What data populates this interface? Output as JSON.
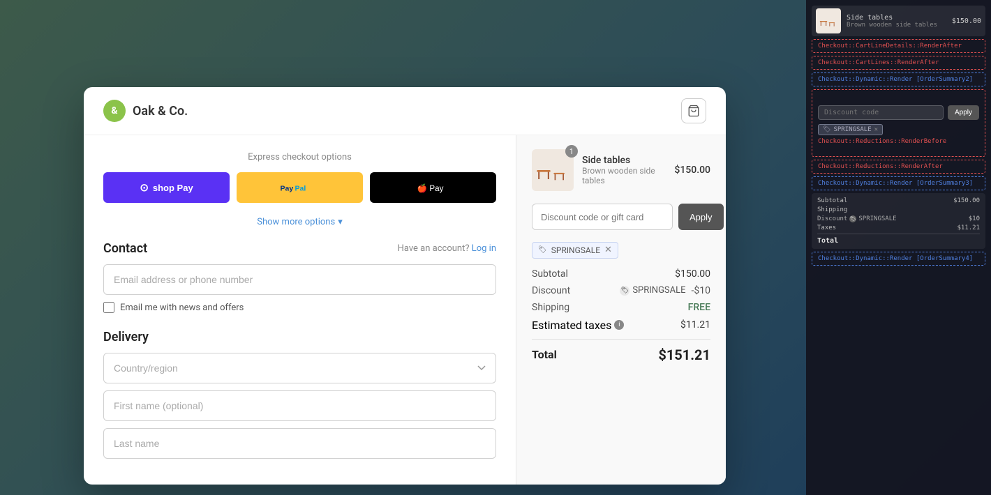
{
  "brand": {
    "icon": "&",
    "name": "Oak & Co."
  },
  "header": {
    "cart_icon": "🛒"
  },
  "express": {
    "title": "Express checkout options",
    "shoppay_label": "shop Pay",
    "paypal_label": "PayPal",
    "applepay_label": "🍎 Pay",
    "show_more": "Show more options"
  },
  "contact": {
    "section_title": "Contact",
    "have_account": "Have an account?",
    "login_link": "Log in",
    "email_placeholder": "Email address or phone number",
    "checkbox_label": "Email me with news and offers"
  },
  "delivery": {
    "section_title": "Delivery",
    "country_placeholder": "Country/region",
    "first_name_placeholder": "First name (optional)",
    "last_name_placeholder": "Last name"
  },
  "order": {
    "product": {
      "name": "Side tables",
      "description": "Brown wooden side tables",
      "price": "$150.00",
      "badge": "1"
    },
    "discount_placeholder": "Discount code or gift card",
    "apply_btn": "Apply",
    "discount_tag": "SPRINGSALE",
    "subtotal_label": "Subtotal",
    "subtotal_value": "$150.00",
    "discount_label": "Discount",
    "discount_code": "SPRINGSALE",
    "discount_value": "-$10",
    "shipping_label": "Shipping",
    "shipping_value": "FREE",
    "taxes_label": "Estimated taxes",
    "taxes_value": "$11.21",
    "total_label": "Total",
    "total_value": "$151.21"
  },
  "dev_panel": {
    "render_cart_line_after": "Checkout::CartLineDetails::RenderAfter",
    "render_cart_lines_after": "Checkout::CartLines::RenderAfter",
    "render_dynamic2": "Checkout::Dynamic::Render [OrderSummary2]",
    "render_reductions_before": "Checkout::Reductions::RenderBefore",
    "discount_placeholder": "Discount code",
    "apply_btn": "Apply",
    "discount_tag": "SPRINGSALE",
    "render_reductions_after": "Checkout::Reductions::RenderAfter",
    "render_dynamic3": "Checkout::Dynamic::Render [OrderSummary3]",
    "subtotal_label": "Subtotal",
    "subtotal_value": "$150.00",
    "shipping_label": "Shipping",
    "discount_label": "Discount",
    "discount_code": "SPRINGSALE",
    "discount_value": "$10",
    "taxes_label": "Taxes",
    "taxes_value": "$11.21",
    "total_label": "Total",
    "render_dynamic4": "Checkout::Dynamic::Render [OrderSummary4]"
  }
}
